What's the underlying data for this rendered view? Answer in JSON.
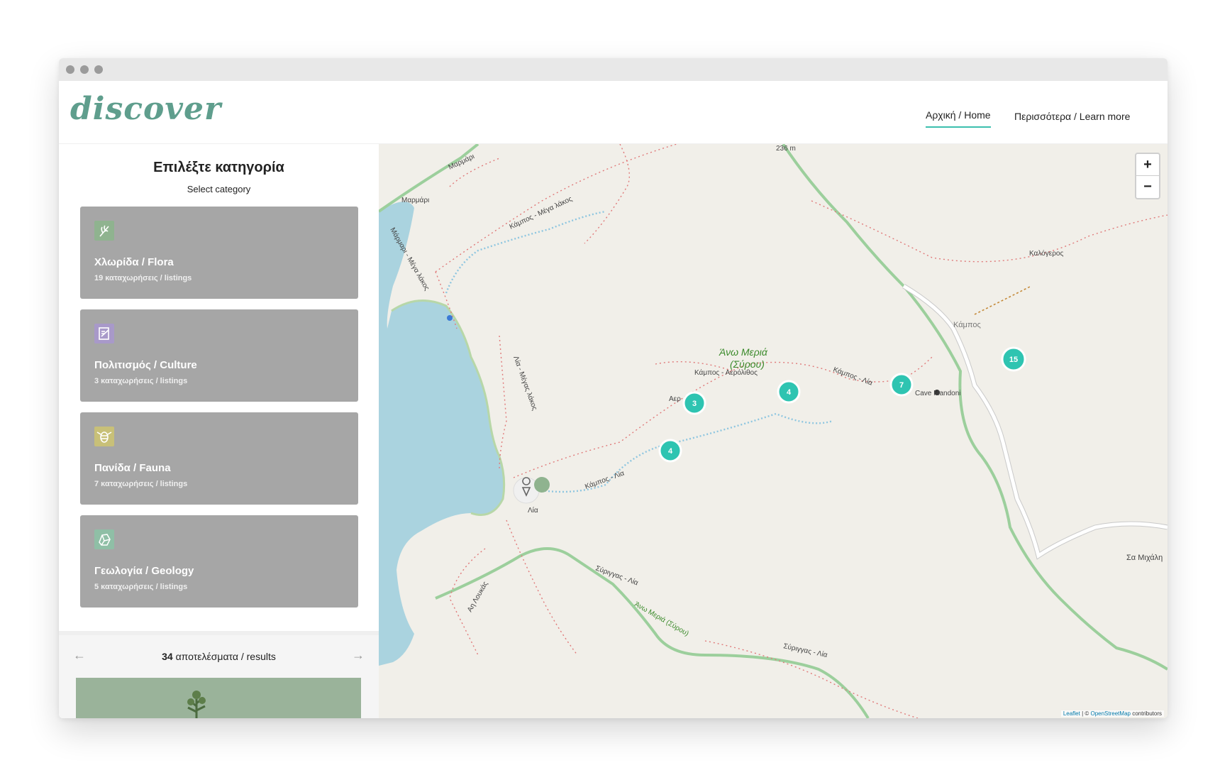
{
  "brand": {
    "logo": "discover",
    "accent": "#3cbfae",
    "logo_color": "#5f9e8d"
  },
  "nav": {
    "home": "Αρχική / Home",
    "more": "Περισσότερα / Learn more"
  },
  "sidebar": {
    "title": "Επιλέξτε κατηγορία",
    "subtitle": "Select category",
    "categories": [
      {
        "label": "Χλωρίδα / Flora",
        "count": "19 καταχωρήσεις / listings",
        "icon": "leaf-icon",
        "icon_color": "#8fb38f"
      },
      {
        "label": "Πολιτισμός / Culture",
        "count": "3 καταχωρήσεις / listings",
        "icon": "scroll-icon",
        "icon_color": "#a899c9"
      },
      {
        "label": "Πανίδα / Fauna",
        "count": "7 καταχωρήσεις / listings",
        "icon": "bee-icon",
        "icon_color": "#c8c078"
      },
      {
        "label": "Γεωλογία / Geology",
        "count": "5 καταχωρήσεις / listings",
        "icon": "rock-icon",
        "icon_color": "#8fbfa6"
      }
    ],
    "results": {
      "count": "34",
      "label": "αποτελέσματα / results"
    }
  },
  "map": {
    "labels": {
      "elevation": "236 m",
      "marmari": "Μαρμάρι",
      "marmari2": "Μαρμάρι",
      "kampos_megalakos": "Κάμπος - Μέγα λάκος",
      "marmari_megalakos": "Μάρμαρι - Μέγα λάκος",
      "lia_megalakos": "Λία - Μέγας λάκος",
      "kalogeros": "Καλόγερος",
      "kampos": "Κάμπος",
      "ano_meria": "Άνω Μεριά",
      "syrou": "(Σύρου)",
      "kampos_aerolithos": "Κάμπος - Αερόλιθος",
      "kampos_lia": "Κάμπος - Λία",
      "kampos_lia2": "Κάμπος - Λία",
      "cave": "Cave Mandoni",
      "aer": "Αερ",
      "lia": "Λία",
      "syriggas_lia": "Σύριγγας - Λία",
      "syriggas_lia2": "Σύριγγας - Λία",
      "ano_meria_syrou": "Άνω Μεριά (Σύρου)",
      "ai_lukas": "Αη Λουκάς",
      "sa_mixali": "Σα Μιχάλη"
    },
    "clusters": [
      "3",
      "4",
      "4",
      "7",
      "15"
    ],
    "zoom_in": "+",
    "zoom_out": "−",
    "attribution": {
      "leaflet": "Leaflet",
      "sep": " | © ",
      "osm": "OpenStreetMap",
      "tail": " contributors"
    },
    "colors": {
      "sea": "#aad3df",
      "land": "#f1efe9",
      "road": "#9ccf9c",
      "cluster": "#2ec4b1"
    }
  }
}
